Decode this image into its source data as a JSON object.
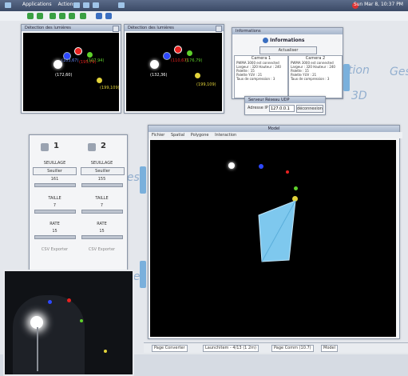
{
  "topbar": {
    "menu": [
      "Applications",
      "Actions"
    ],
    "clock": "Sun Mar 8, 10:37 PM"
  },
  "windows": {
    "detection_left": {
      "title": "Détection des lumières",
      "points": [
        "(172,60)",
        "(103,67)",
        "(195,79)",
        "(107,94)",
        "(199,109)"
      ]
    },
    "detection_right": {
      "title": "Détection des lumières",
      "points": [
        "(132,36)",
        "(110,67)",
        "(176,79)",
        "(199,109)"
      ]
    },
    "info": {
      "title": "Informations",
      "header": "Informations",
      "refresh": "Actualiser",
      "cam1": {
        "name": "Camera 1",
        "lines": [
          "PWMA 3000 est connected",
          "Largeur : 320 Hauteur : 240",
          "Palette : 15",
          "Palette YUV : 21",
          "Taux de compression : 3"
        ]
      },
      "cam2": {
        "name": "Camera 2",
        "lines": [
          "PWMA 3000 est connected",
          "Largeur : 320 Hauteur : 240",
          "Palette : 15",
          "Palette YUV : 21",
          "Taux de compression : 3"
        ]
      }
    },
    "server": {
      "title": "Serveur Réseau UDP",
      "address_label": "Adresse IP",
      "address_value": "127.0.0.1",
      "connect": "déconnexion"
    },
    "settings": {
      "col1": {
        "num": "1",
        "seuil": "SEUILLAGE",
        "btn": "Seuiller",
        "seuil_val": "161",
        "taille": "TAILLE",
        "taille_val": "7",
        "rate": "RATE",
        "rate_val": "15",
        "export": "CSV Exporter"
      },
      "col2": {
        "num": "2",
        "seuil": "SEUILLAGE",
        "btn": "Seuiller",
        "seuil_val": "155",
        "taille": "TAILLE",
        "taille_val": "7",
        "rate": "RATE",
        "rate_val": "15",
        "export": "CSV Exporter"
      }
    },
    "model": {
      "title": "Model",
      "menu": [
        "Fichier",
        "Spatial",
        "Polygone",
        "Interaction"
      ]
    }
  },
  "handwriting": [
    "tion",
    "Ges",
    "3D",
    "Ges",
    "Ges"
  ],
  "status": {
    "seg1": "Page Converter",
    "seg2": "Launchitem - 4/13 (1 2m)",
    "seg3": "Page Comm (10.7)",
    "seg4": "Model"
  },
  "colors": {
    "blue_face": "#7ec8ee",
    "white_dot": "#ffffff",
    "blue_dot": "#2d48ff",
    "red_dot": "#e8211f",
    "green_dot": "#5fd12b",
    "yellow_dot": "#e2d33a"
  }
}
